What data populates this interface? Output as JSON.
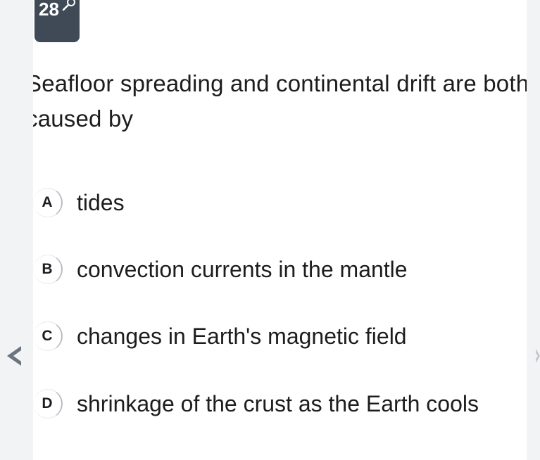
{
  "question": {
    "number": "28",
    "text": "Seafloor spreading and continental drift are both caused by"
  },
  "options": [
    {
      "letter": "A",
      "text": "tides"
    },
    {
      "letter": "B",
      "text": "convection currents in the mantle"
    },
    {
      "letter": "C",
      "text": "changes in Earth's magnetic field"
    },
    {
      "letter": "D",
      "text": "shrinkage of the crust as the Earth cools"
    }
  ],
  "icons": {
    "badge": "wrench-icon",
    "prev": "chevron-left-icon",
    "next": "chevron-right-icon"
  },
  "colors": {
    "badge_bg": "#3f4a56",
    "page_bg": "#f2f3f5",
    "card_bg": "#ffffff"
  }
}
